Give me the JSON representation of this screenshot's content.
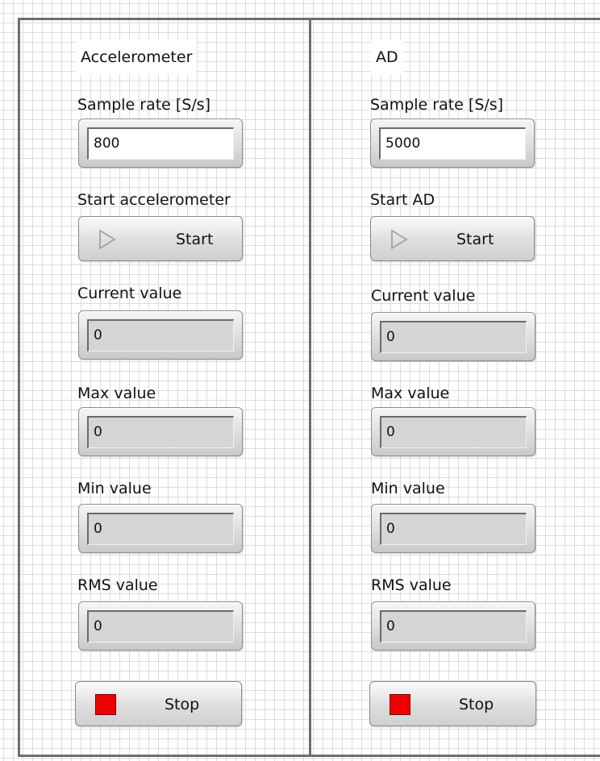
{
  "accelerometer": {
    "title": "Accelerometer",
    "sample_rate_label": "Sample rate [S/s]",
    "sample_rate_value": "800",
    "start_label": "Start accelerometer",
    "start_button": "Start",
    "current_label": "Current value",
    "current_value": "0",
    "max_label": "Max value",
    "max_value": "0",
    "min_label": "Min value",
    "min_value": "0",
    "rms_label": "RMS value",
    "rms_value": "0",
    "stop_button": "Stop"
  },
  "ad": {
    "title": "AD",
    "sample_rate_label": "Sample rate [S/s]",
    "sample_rate_value": "5000",
    "start_label": "Start AD",
    "start_button": "Start",
    "current_label": "Current value",
    "current_value": "0",
    "max_label": "Max value",
    "max_value": "0",
    "min_label": "Min value",
    "min_value": "0",
    "rms_label": "RMS value",
    "rms_value": "0",
    "stop_button": "Stop"
  },
  "colors": {
    "stop_led": "#ee0000",
    "panel_border": "#6e6e6e",
    "grid": "#dcdcdc"
  },
  "icons": {
    "start": "play-icon",
    "stop": "stop-square-icon"
  }
}
